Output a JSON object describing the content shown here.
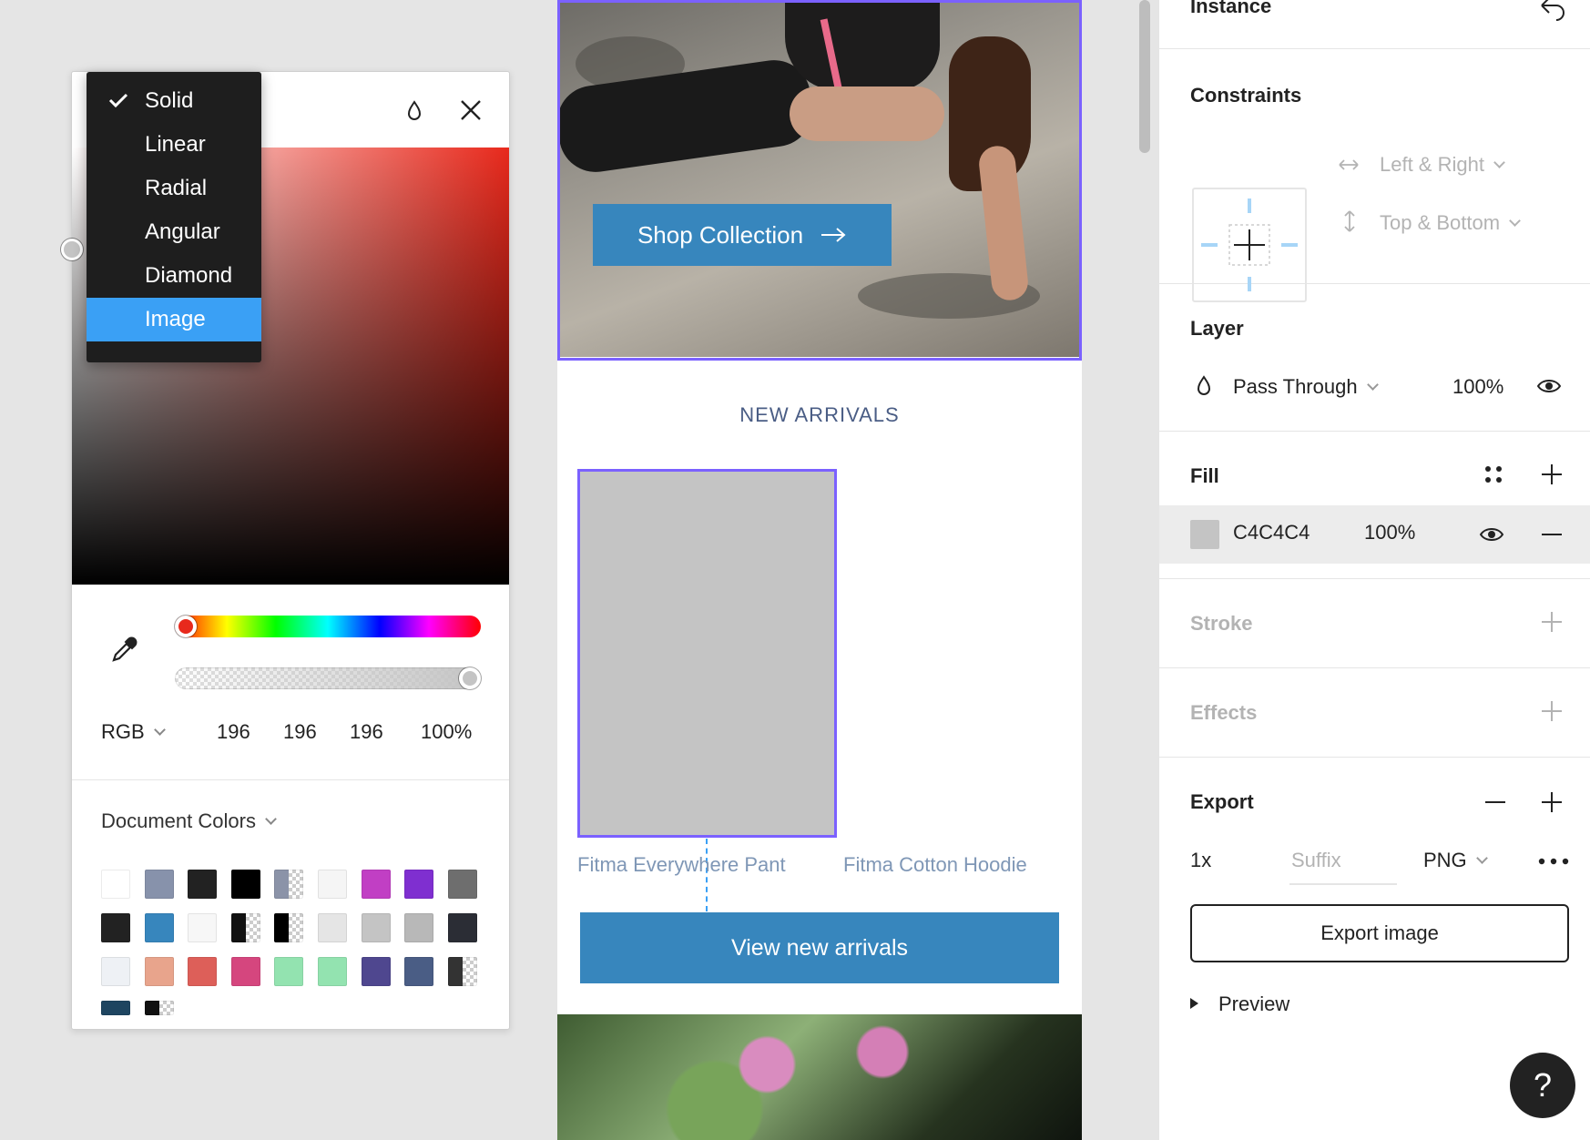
{
  "fill_type_menu": {
    "items": [
      "Solid",
      "Linear",
      "Radial",
      "Angular",
      "Diamond",
      "Image"
    ],
    "checked": "Solid",
    "highlighted": "Image"
  },
  "color_picker": {
    "mode": "RGB",
    "r": "196",
    "g": "196",
    "b": "196",
    "alpha": "100%",
    "document_colors_label": "Document Colors",
    "swatches": [
      "#ffffff",
      "#8792ab",
      "#222222",
      "#000000",
      "#8b93a8",
      "#f5f5f5",
      "#c13fc4",
      "#7f2fd0",
      "#6e6e6e",
      "#222222",
      "#3786bd",
      "#f7f7f7",
      "#111111",
      "#000000",
      "#e5e5e5",
      "#c4c4c4",
      "#b8b8b8",
      "#2b2d35",
      "#eef1f5",
      "#e8a48c",
      "#dd5f59",
      "#d5467e",
      "#93e3b0",
      "#93e3b0",
      "#4f478f",
      "#4a5d85",
      "#333333",
      "#1e4560",
      "#111111"
    ]
  },
  "canvas": {
    "shop_button": "Shop Collection",
    "section_heading": "NEW ARRIVALS",
    "product_1": "Fitma Everywhere Pant",
    "product_2": "Fitma Cotton Hoodie",
    "view_button": "View new arrivals"
  },
  "panel": {
    "instance_title": "Instance",
    "constraints": {
      "title": "Constraints",
      "horizontal": "Left & Right",
      "vertical": "Top & Bottom"
    },
    "layer": {
      "title": "Layer",
      "blend": "Pass Through",
      "opacity": "100%"
    },
    "fill": {
      "title": "Fill",
      "hex": "C4C4C4",
      "opacity": "100%",
      "color": "#c4c4c4"
    },
    "stroke_title": "Stroke",
    "effects_title": "Effects",
    "export": {
      "title": "Export",
      "scale": "1x",
      "suffix_placeholder": "Suffix",
      "format": "PNG",
      "button": "Export image",
      "preview": "Preview"
    }
  },
  "help_label": "?",
  "colors": {
    "accent": "#3aa0f5",
    "selection": "#7b61ff",
    "button_blue": "#3786bd"
  }
}
